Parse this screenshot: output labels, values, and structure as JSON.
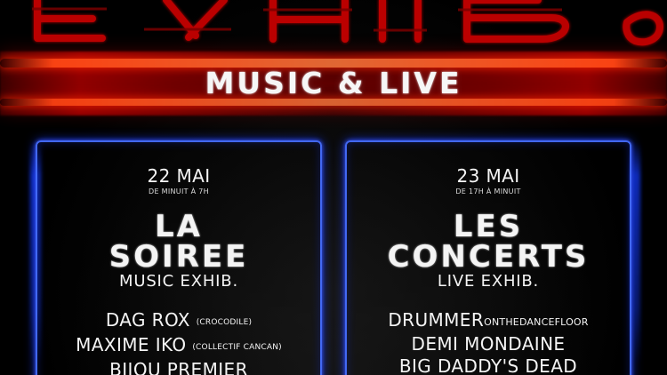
{
  "logo": {
    "text": "EXHIB."
  },
  "header": {
    "title": "MUSIC & LIVE"
  },
  "events": [
    {
      "date": "22 MAI",
      "time": "DE MINUIT À 7H",
      "title_lines": [
        "LA",
        "SOIREE"
      ],
      "subtitle": "MUSIC EXHIB.",
      "artists": [
        {
          "name": "DAG ROX",
          "detail": "(CROCODILE)"
        },
        {
          "name": "MAXIME IKO",
          "detail": "(COLLECTIF CANCAN)"
        },
        {
          "name": "BIJOU PREMIER",
          "detail": ""
        }
      ]
    },
    {
      "date": "23 MAI",
      "time": "DE 17H À MINUIT",
      "title_lines": [
        "LES",
        "CONCERTS"
      ],
      "subtitle": "LIVE EXHIB.",
      "artists": [
        {
          "name": "DRUMMER",
          "detail": "ONTHEDANCEFLOOR"
        },
        {
          "name": "DEMI MONDAINE",
          "detail": ""
        },
        {
          "name": "BIG DADDY'S DEAD",
          "detail": ""
        }
      ]
    }
  ],
  "colors": {
    "logo_red": "#c50000",
    "accent_blue": "#2f5cff",
    "text_white": "#f4f4f4",
    "background": "#030303"
  }
}
